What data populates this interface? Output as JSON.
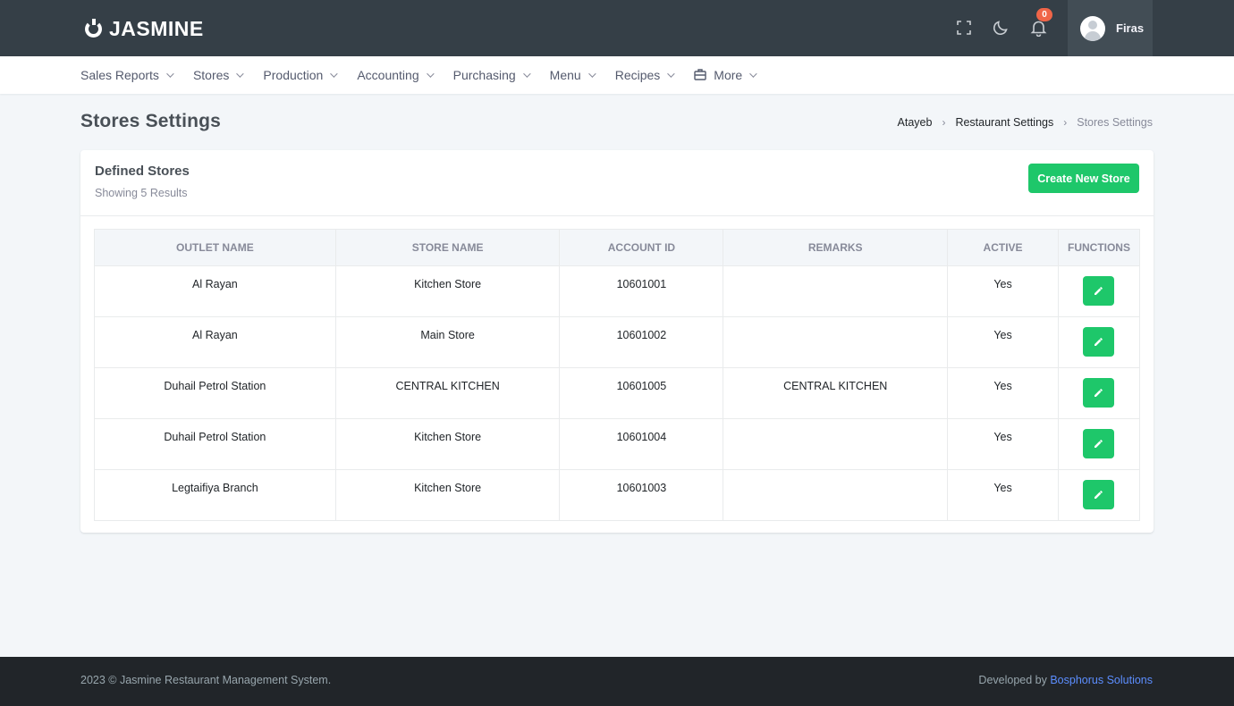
{
  "brand": {
    "name": "JASMINE"
  },
  "header": {
    "notification_count": "0",
    "user_name": "Firas",
    "icons": [
      "fullscreen-icon",
      "moon-icon",
      "bell-icon",
      "user-avatar-icon"
    ]
  },
  "nav": {
    "items": [
      {
        "label": "Sales Reports"
      },
      {
        "label": "Stores"
      },
      {
        "label": "Production"
      },
      {
        "label": "Accounting"
      },
      {
        "label": "Purchasing"
      },
      {
        "label": "Menu"
      },
      {
        "label": "Recipes"
      },
      {
        "label": "More"
      }
    ]
  },
  "page": {
    "title": "Stores Settings",
    "breadcrumb": [
      "Atayeb",
      "Restaurant Settings",
      "Stores Settings"
    ]
  },
  "card": {
    "title": "Defined Stores",
    "subtitle": "Showing 5 Results",
    "create_button": "Create New Store"
  },
  "table": {
    "columns": [
      "OUTLET NAME",
      "STORE NAME",
      "ACCOUNT ID",
      "REMARKS",
      "ACTIVE",
      "FUNCTIONS"
    ],
    "rows": [
      {
        "outlet": "Al Rayan",
        "store": "Kitchen Store",
        "account": "10601001",
        "remarks": "",
        "active": "Yes"
      },
      {
        "outlet": "Al Rayan",
        "store": "Main Store",
        "account": "10601002",
        "remarks": "",
        "active": "Yes"
      },
      {
        "outlet": "Duhail Petrol Station",
        "store": "CENTRAL KITCHEN",
        "account": "10601005",
        "remarks": "CENTRAL KITCHEN",
        "active": "Yes"
      },
      {
        "outlet": "Duhail Petrol Station",
        "store": "Kitchen Store",
        "account": "10601004",
        "remarks": "",
        "active": "Yes"
      },
      {
        "outlet": "Legtaifiya Branch",
        "store": "Kitchen Store",
        "account": "10601003",
        "remarks": "",
        "active": "Yes"
      }
    ]
  },
  "footer": {
    "copyright": "2023 © Jasmine Restaurant Management System.",
    "developed_by": "Developed by ",
    "developer": "Bosphorus Solutions"
  },
  "colors": {
    "topbar": "#353f47",
    "accent_green": "#1ec76a",
    "badge_red": "#f06548",
    "footer": "#212529",
    "link_blue": "#5c8eff"
  }
}
